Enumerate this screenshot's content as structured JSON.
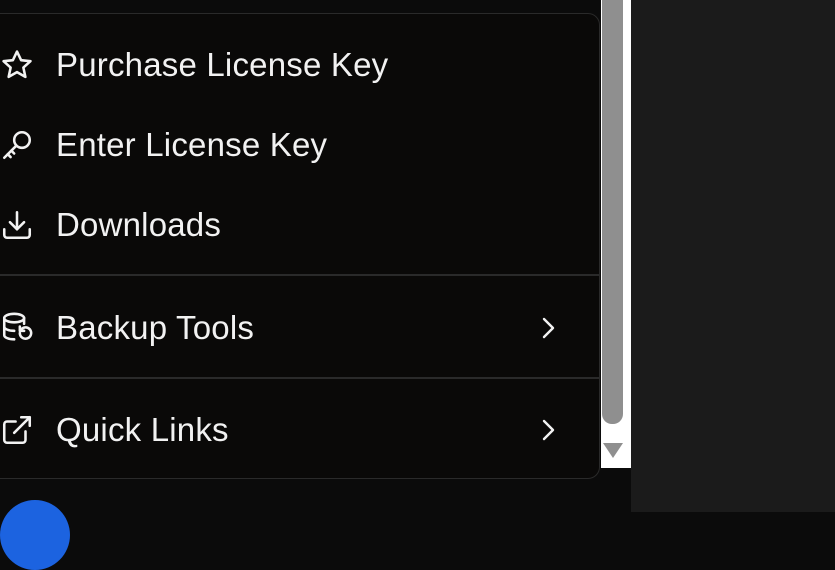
{
  "menu": {
    "items": [
      {
        "label": "Purchase License Key",
        "icon": "star-icon",
        "has_submenu": false
      },
      {
        "label": "Enter License Key",
        "icon": "key-icon",
        "has_submenu": false
      },
      {
        "label": "Downloads",
        "icon": "download-icon",
        "has_submenu": false
      },
      {
        "label": "Backup Tools",
        "icon": "database-restore-icon",
        "has_submenu": true
      },
      {
        "label": "Quick Links",
        "icon": "external-link-icon",
        "has_submenu": true
      }
    ]
  },
  "colors": {
    "menu_bg": "#0a0908",
    "text": "#f2f2f2",
    "divider": "#2a2a2a",
    "right_pane": "#1b1b1b",
    "avatar": "#1c63e0"
  }
}
